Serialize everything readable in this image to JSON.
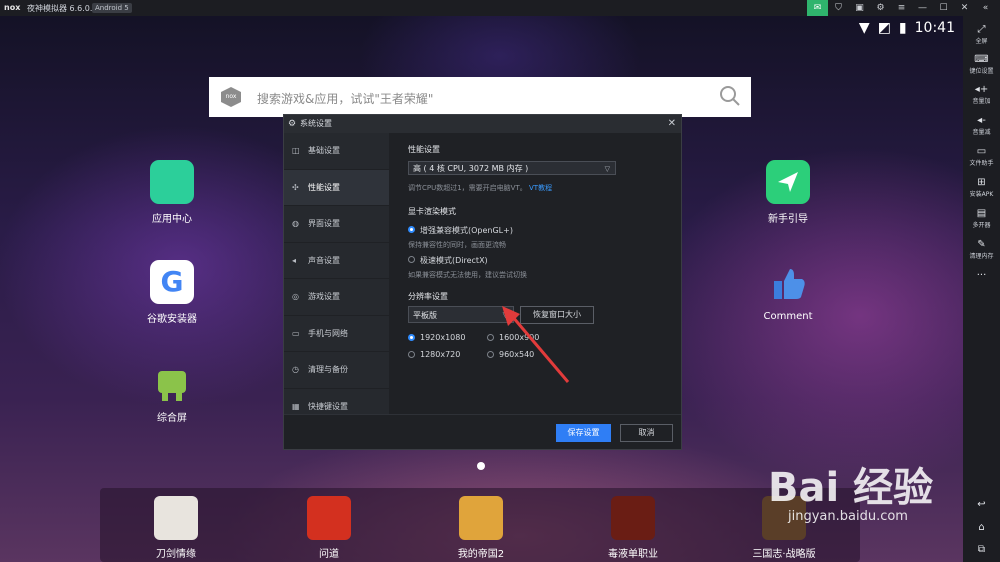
{
  "titlebar": {
    "logo": "nox",
    "title": "夜神模拟器 6.6.0.5",
    "badge": "Android 5",
    "icons": [
      "mail-icon",
      "shirt-icon",
      "gift-icon",
      "settings-icon",
      "menu-icon",
      "minimize-icon",
      "maximize-icon",
      "close-icon",
      "collapse-icon"
    ]
  },
  "status": {
    "time": "10:41"
  },
  "search": {
    "placeholder": "搜索游戏&应用，试试\"王者荣耀\""
  },
  "desktop_apps": [
    {
      "label": "应用中心",
      "icon": "app-center-icon"
    },
    {
      "label": "谷歌安装器",
      "icon": "google-icon"
    },
    {
      "label": "综合屏",
      "icon": "android-icon"
    },
    {
      "label": "新手引导",
      "icon": "guide-icon"
    },
    {
      "label": "Comment",
      "icon": "thumbs-up-icon"
    }
  ],
  "dock": [
    {
      "label": "刀剑情缘"
    },
    {
      "label": "问道"
    },
    {
      "label": "我的帝国2"
    },
    {
      "label": "毒液单职业"
    },
    {
      "label": "三国志·战略版"
    }
  ],
  "right_sidebar": [
    {
      "label": "全屏",
      "icon": "fullscreen-icon"
    },
    {
      "label": "键位设置",
      "icon": "keyboard-icon"
    },
    {
      "label": "音量加",
      "icon": "volume-up-icon"
    },
    {
      "label": "音量减",
      "icon": "volume-down-icon"
    },
    {
      "label": "文件助手",
      "icon": "file-icon"
    },
    {
      "label": "安装APK",
      "icon": "apk-icon"
    },
    {
      "label": "多开器",
      "icon": "multi-icon"
    },
    {
      "label": "清理内存",
      "icon": "broom-icon"
    },
    {
      "label": "···",
      "icon": "more-icon"
    }
  ],
  "nav_buttons": [
    "back-icon",
    "home-icon",
    "recent-icon"
  ],
  "dialog": {
    "title": "系统设置",
    "nav": [
      {
        "label": "基础设置",
        "icon": "basic-icon",
        "active": false
      },
      {
        "label": "性能设置",
        "icon": "performance-icon",
        "active": true
      },
      {
        "label": "界面设置",
        "icon": "interface-icon",
        "active": false
      },
      {
        "label": "声音设置",
        "icon": "sound-icon",
        "active": false
      },
      {
        "label": "游戏设置",
        "icon": "game-icon",
        "active": false
      },
      {
        "label": "手机与网络",
        "icon": "phone-icon",
        "active": false
      },
      {
        "label": "清理与备份",
        "icon": "cleanup-icon",
        "active": false
      },
      {
        "label": "快捷键设置",
        "icon": "shortcut-icon",
        "active": false
      }
    ],
    "performance": {
      "heading": "性能设置",
      "select_value": "高 ( 4 核 CPU, 3072 MB 内存 )",
      "hint": "调节CPU数超过1，需要开启电脑VT。",
      "hint_link": "VT教程"
    },
    "graphics": {
      "heading": "显卡渲染模式",
      "option1": "增强兼容模式(OpenGL+)",
      "option1_hint": "保持兼容性的同时，画面更流畅",
      "option2": "极速模式(DirectX)",
      "option2_hint": "如果兼容模式无法使用，建议尝试切换",
      "selected": "option1"
    },
    "resolution": {
      "heading": "分辨率设置",
      "select_value": "平板版",
      "restore_button": "恢复窗口大小",
      "options": [
        "1920x1080",
        "1600x900",
        "1280x720",
        "960x540"
      ],
      "selected": "1920x1080"
    },
    "save_button": "保存设置",
    "cancel_button": "取消"
  },
  "watermark": {
    "text": "Bai 经验",
    "sub": "jingyan.baidu.com"
  },
  "colors": {
    "accent": "#2f7ef5",
    "annotation_arrow": "#e23b3b"
  }
}
